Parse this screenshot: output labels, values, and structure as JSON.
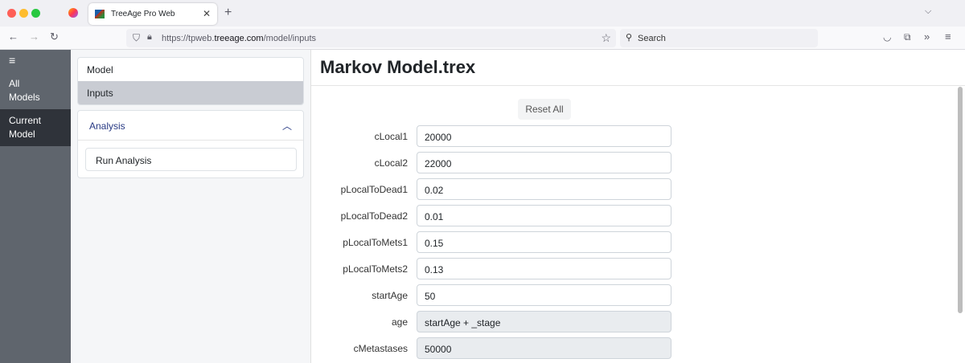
{
  "browser": {
    "tab_title": "TreeAge Pro Web",
    "url_prefix": "https://tpweb.",
    "url_domain": "treeage.com",
    "url_path": "/model/inputs",
    "search_placeholder": "Search"
  },
  "leftnav": {
    "items": [
      {
        "line1": "All",
        "line2": "Models"
      },
      {
        "line1": "Current",
        "line2": "Model"
      }
    ]
  },
  "midpanel": {
    "model": "Model",
    "inputs": "Inputs",
    "analysis": "Analysis",
    "run_analysis": "Run Analysis"
  },
  "main": {
    "title": "Markov Model.trex",
    "reset_all": "Reset All",
    "inputs": [
      {
        "label": "cLocal1",
        "value": "20000",
        "disabled": false
      },
      {
        "label": "cLocal2",
        "value": "22000",
        "disabled": false
      },
      {
        "label": "pLocalToDead1",
        "value": "0.02",
        "disabled": false
      },
      {
        "label": "pLocalToDead2",
        "value": "0.01",
        "disabled": false
      },
      {
        "label": "pLocalToMets1",
        "value": "0.15",
        "disabled": false
      },
      {
        "label": "pLocalToMets2",
        "value": "0.13",
        "disabled": false
      },
      {
        "label": "startAge",
        "value": "50",
        "disabled": false
      },
      {
        "label": "age",
        "value": "startAge + _stage",
        "disabled": true
      },
      {
        "label": "cMetastases",
        "value": "50000",
        "disabled": true
      }
    ]
  }
}
